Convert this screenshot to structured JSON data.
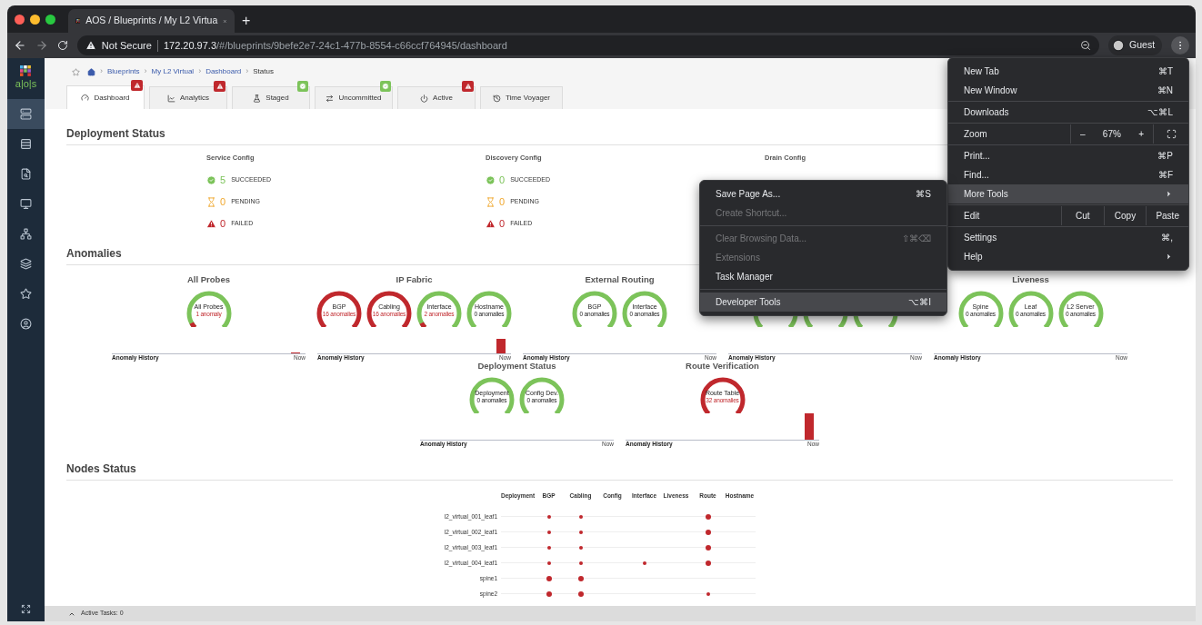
{
  "browser": {
    "tab_title": "AOS / Blueprints / My L2 Virtua",
    "new_tab": "+",
    "security": "Not Secure",
    "host": "172.20.97.3",
    "path": "/#/blueprints/9befe2e7-24c1-477b-8554-c66ccf764945/dashboard",
    "profile": "Guest"
  },
  "sidebar": {
    "logo_text": "a|o|s",
    "items": [
      {
        "selected": true
      },
      {
        "selected": false
      },
      {
        "selected": false
      },
      {
        "selected": false
      },
      {
        "selected": false
      },
      {
        "selected": false
      },
      {
        "selected": false
      },
      {
        "selected": false
      }
    ]
  },
  "breadcrumb": [
    {
      "separator": "›",
      "label": "Blueprints",
      "current": false
    },
    {
      "separator": "›",
      "label": "My L2 Virtual",
      "current": false
    },
    {
      "separator": "›",
      "label": "Dashboard",
      "current": false
    },
    {
      "separator": "›",
      "label": "Status",
      "current": true
    }
  ],
  "tabs": [
    {
      "label": "Dashboard",
      "selected": true,
      "badge": {
        "kind": "alert"
      }
    },
    {
      "label": "Analytics",
      "selected": false,
      "badge": {
        "kind": "alert"
      }
    },
    {
      "label": "Staged",
      "selected": false,
      "badge": {
        "kind": "ok"
      }
    },
    {
      "label": "Uncommitted",
      "selected": false,
      "badge": {
        "kind": "ok"
      }
    },
    {
      "label": "Active",
      "selected": false,
      "badge": {
        "kind": "alert"
      }
    },
    {
      "label": "Time Voyager",
      "selected": false
    }
  ],
  "deployment_status": {
    "title": "Deployment Status",
    "columns": [
      {
        "title": "Service Config",
        "rows": [
          {
            "kind": "succeeded",
            "count": "5",
            "label": "SUCCEEDED"
          },
          {
            "kind": "pending",
            "count": "0",
            "label": "PENDING"
          },
          {
            "kind": "failed",
            "count": "0",
            "label": "FAILED"
          }
        ]
      },
      {
        "title": "Discovery Config",
        "rows": [
          {
            "kind": "succeeded",
            "count": "0",
            "label": "SUCCEEDED"
          },
          {
            "kind": "pending",
            "count": "0",
            "label": "PENDING"
          },
          {
            "kind": "failed",
            "count": "0",
            "label": "FAILED"
          }
        ]
      },
      {
        "title": "Drain Config"
      }
    ]
  },
  "anomalies": {
    "title": "Anomalies",
    "rows": [
      [
        {
          "title": "All Probes",
          "gauges": [
            {
              "name": "All Probes",
              "count": "1 anomaly",
              "kind": "warning"
            }
          ],
          "history": {
            "label": "Anomaly History",
            "end": "Now",
            "kind": "trace"
          }
        },
        {
          "title": "IP Fabric",
          "gauges": [
            {
              "name": "BGP",
              "count": "16 anomalies",
              "kind": "critical"
            },
            {
              "name": "Cabling",
              "count": "16 anomalies",
              "kind": "critical"
            },
            {
              "name": "Interface",
              "count": "2 anomalies",
              "kind": "warning"
            },
            {
              "name": "Hostname",
              "count": "0 anomalies",
              "kind": "ok"
            }
          ],
          "history": {
            "label": "Anomaly History",
            "end": "Now",
            "kind": "medium"
          }
        },
        {
          "title": "External Routing",
          "gauges": [
            {
              "name": "BGP",
              "count": "0 anomalies",
              "kind": "ok"
            },
            {
              "name": "Interface",
              "count": "0 anomalies",
              "kind": "ok"
            }
          ],
          "history": {
            "label": "Anomaly History",
            "end": "Now",
            "kind": "none"
          }
        },
        {
          "gauges": [
            {
              "kind": "ok"
            },
            {
              "kind": "ok"
            },
            {
              "kind": "ok"
            }
          ],
          "history": {
            "label": "Anomaly History",
            "end": "Now",
            "kind": "none"
          }
        },
        {
          "title": "Liveness",
          "gauges": [
            {
              "name": "Spine",
              "count": "0 anomalies",
              "kind": "ok"
            },
            {
              "name": "Leaf",
              "count": "0 anomalies",
              "kind": "ok"
            },
            {
              "name": "L2 Server",
              "count": "0 anomalies",
              "kind": "ok"
            }
          ],
          "history": {
            "label": "Anomaly History",
            "end": "Now",
            "kind": "none"
          }
        }
      ],
      [
        {
          "title": "Deployment Status",
          "gauges": [
            {
              "name": "Deployment",
              "count": "0 anomalies",
              "kind": "ok"
            },
            {
              "name": "Config Dev.",
              "count": "0 anomalies",
              "kind": "ok"
            }
          ],
          "history": {
            "label": "Anomaly History",
            "end": "Now",
            "kind": "none"
          }
        },
        {
          "title": "Route Verification",
          "gauges": [
            {
              "name": "Route Table",
              "count": "32 anomalies",
              "kind": "critical"
            }
          ],
          "history": {
            "label": "Anomaly History",
            "end": "Now",
            "kind": "high"
          }
        }
      ]
    ]
  },
  "nodes_status": {
    "title": "Nodes Status",
    "columns": [
      "Deployment",
      "BGP",
      "Cabling",
      "Config",
      "Interface",
      "Liveness",
      "Route",
      "Hostname"
    ],
    "rows": [
      {
        "name": "l2_virtual_001_leaf1",
        "cells": [
          {
            "kind": "none"
          },
          {
            "kind": "minor"
          },
          {
            "kind": "minor"
          },
          {
            "kind": "none"
          },
          {
            "kind": "none"
          },
          {
            "kind": "none"
          },
          {
            "kind": "major"
          },
          {
            "kind": "none"
          }
        ]
      },
      {
        "name": "l2_virtual_002_leaf1",
        "cells": [
          {
            "kind": "none"
          },
          {
            "kind": "minor"
          },
          {
            "kind": "minor"
          },
          {
            "kind": "none"
          },
          {
            "kind": "none"
          },
          {
            "kind": "none"
          },
          {
            "kind": "major"
          },
          {
            "kind": "none"
          }
        ]
      },
      {
        "name": "l2_virtual_003_leaf1",
        "cells": [
          {
            "kind": "none"
          },
          {
            "kind": "minor"
          },
          {
            "kind": "minor"
          },
          {
            "kind": "none"
          },
          {
            "kind": "none"
          },
          {
            "kind": "none"
          },
          {
            "kind": "major"
          },
          {
            "kind": "none"
          }
        ]
      },
      {
        "name": "l2_virtual_004_leaf1",
        "cells": [
          {
            "kind": "none"
          },
          {
            "kind": "minor"
          },
          {
            "kind": "minor"
          },
          {
            "kind": "none"
          },
          {
            "kind": "minor"
          },
          {
            "kind": "none"
          },
          {
            "kind": "major"
          },
          {
            "kind": "none"
          }
        ]
      },
      {
        "name": "spine1",
        "cells": [
          {
            "kind": "none"
          },
          {
            "kind": "major"
          },
          {
            "kind": "major"
          },
          {
            "kind": "none"
          },
          {
            "kind": "none"
          },
          {
            "kind": "none"
          },
          {
            "kind": "none"
          },
          {
            "kind": "none"
          }
        ]
      },
      {
        "name": "spine2",
        "cells": [
          {
            "kind": "none"
          },
          {
            "kind": "major"
          },
          {
            "kind": "major"
          },
          {
            "kind": "none"
          },
          {
            "kind": "none"
          },
          {
            "kind": "none"
          },
          {
            "kind": "minor"
          },
          {
            "kind": "none"
          }
        ]
      }
    ]
  },
  "status_bar": {
    "text": "Active Tasks: 0"
  },
  "chrome_menu": [
    {
      "kind": "item",
      "label": "New Tab",
      "shortcut": "⌘T",
      "highlighted": false,
      "disabled": false
    },
    {
      "kind": "item",
      "label": "New Window",
      "shortcut": "⌘N",
      "highlighted": false,
      "disabled": false
    },
    {
      "kind": "separator"
    },
    {
      "kind": "item",
      "label": "Downloads",
      "shortcut": "⌥⌘L",
      "highlighted": false,
      "disabled": false
    },
    {
      "kind": "separator"
    },
    {
      "kind": "zoom",
      "label": "Zoom",
      "minus": "–",
      "value": "67%",
      "plus": "+"
    },
    {
      "kind": "separator"
    },
    {
      "kind": "item",
      "label": "Print...",
      "shortcut": "⌘P",
      "highlighted": false,
      "disabled": false
    },
    {
      "kind": "item",
      "label": "Find...",
      "shortcut": "⌘F",
      "highlighted": false,
      "disabled": false
    },
    {
      "kind": "item",
      "label": "More Tools",
      "submenu": true,
      "highlighted": true,
      "disabled": false
    },
    {
      "kind": "separator"
    },
    {
      "kind": "edit",
      "label": "Edit",
      "actions": [
        "Cut",
        "Copy",
        "Paste"
      ]
    },
    {
      "kind": "separator"
    },
    {
      "kind": "item",
      "label": "Settings",
      "shortcut": "⌘,",
      "highlighted": false,
      "disabled": false
    },
    {
      "kind": "item",
      "label": "Help",
      "submenu": true,
      "highlighted": false,
      "disabled": false
    }
  ],
  "more_tools_menu": [
    {
      "kind": "item",
      "label": "Save Page As...",
      "shortcut": "⌘S",
      "highlighted": false,
      "disabled": false
    },
    {
      "kind": "item",
      "label": "Create Shortcut...",
      "highlighted": false,
      "disabled": true
    },
    {
      "kind": "separator"
    },
    {
      "kind": "item",
      "label": "Clear Browsing Data...",
      "shortcut": "⇧⌘⌫",
      "highlighted": false,
      "disabled": true
    },
    {
      "kind": "item",
      "label": "Extensions",
      "highlighted": false,
      "disabled": true
    },
    {
      "kind": "item",
      "label": "Task Manager",
      "highlighted": false,
      "disabled": false
    },
    {
      "kind": "separator"
    },
    {
      "kind": "item",
      "label": "Developer Tools",
      "shortcut": "⌥⌘I",
      "highlighted": true,
      "disabled": false
    }
  ]
}
